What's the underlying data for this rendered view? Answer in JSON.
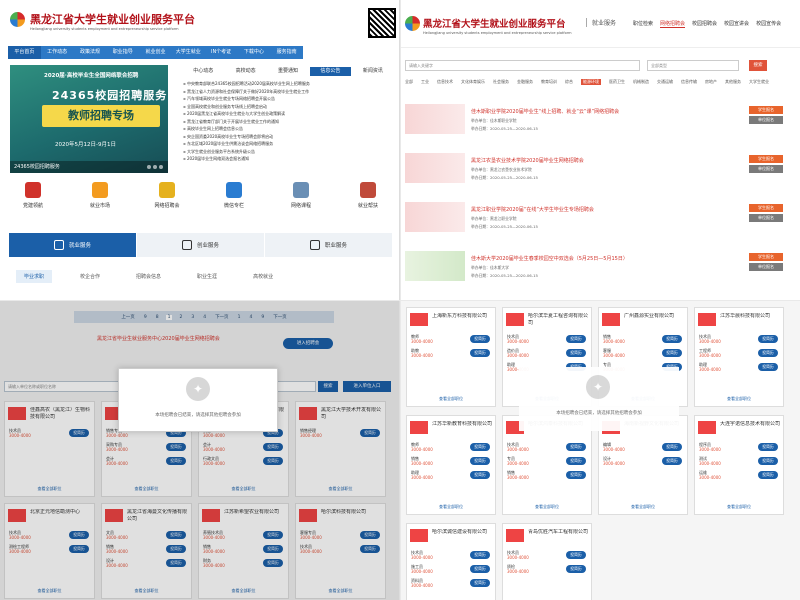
{
  "q1": {
    "title": "黑龙江省大学生就业创业服务平台",
    "subtitle": "Heilongjiang university students employment and entrepreneurship service platform",
    "nav": [
      "平台首页",
      "工作动态",
      "政策法规",
      "职业指导",
      "就业创业",
      "大学生就业",
      "IN个考证",
      "下载中心",
      "服务指南"
    ],
    "banner": {
      "header": "2020届·高校毕业生全国网络联合招聘",
      "big": "24365校园招聘服务",
      "zc": "教师招聘专场",
      "date": "2020年5月12日-9月1日",
      "foot": "24365校园招聘服务"
    },
    "news_tabs": [
      "中心动态",
      "高校动态",
      "重要通知",
      "信息公告",
      "新闻资讯"
    ],
    "news": [
      "中央教育部联合24365校园招聘活动2020届高校毕业生网上招聘服务",
      "黑龙江省人力资源和社会保障厅关于做好2020年高校毕业生就业工作",
      "汽车领域高校毕业生就业专场网络招聘会开展公告",
      "全国高校就业和创业服务专场线上招聘会启动",
      "2020届黑龙江省高校毕业生就业与大学生创业政策解读",
      "黑龙江省教育厅部门关于开展毕业生就业工作的通知",
      "高校毕业生网上招聘会信息公告",
      "央企国资委2020高校毕业生专场招聘会即将启动",
      "东北区域2020届毕业生供需洽谈会网络招聘服务",
      "大学生就业创业服务平台系统升级公告",
      "2020届毕业生网络双选会报名通知"
    ],
    "icons": [
      {
        "label": "党建领航",
        "color": "#d0322b"
      },
      {
        "label": "就业市场",
        "color": "#f39b1f"
      },
      {
        "label": "网络招聘会",
        "color": "#e5b11e"
      },
      {
        "label": "微信专栏",
        "color": "#2a7cd1"
      },
      {
        "label": "网络课程",
        "color": "#6a8fb5"
      },
      {
        "label": "就业帮扶",
        "color": "#c04a3a"
      }
    ],
    "services": [
      "就业服务",
      "创业服务",
      "职业服务"
    ],
    "subtabs": [
      "毕业求职",
      "校企合作",
      "招聘会信息",
      "职业生涯",
      "高校就业"
    ]
  },
  "q2": {
    "title": "黑龙江省大学生就业创业服务平台",
    "subtitle": "Heilongjiang university students employment and entrepreneurship service platform",
    "section": "就业服务",
    "nav": [
      "职位检索",
      "网络招聘会",
      "校园招聘会",
      "校园宣讲会",
      "校园宣传会"
    ],
    "search_placeholder": "请输入关键字",
    "search_sel": "全部类型",
    "search_btn": "搜索",
    "hot": [
      "全部",
      "工业",
      "信息技术",
      "文化体育娱乐",
      "社会服务",
      "金融服务",
      "教育培训",
      "综合",
      "能源环境",
      "医药卫生",
      "机械制造",
      "交通运输",
      "信息传输",
      "房地产",
      "其他服务",
      "大学生就业"
    ],
    "jobs": [
      {
        "title": "佳木斯职业学院2020届毕业生“线上招聘、就业“云”课”网络招聘会",
        "org": "举办单位：佳木斯职业学院",
        "date": "举办日期：2020-05-25—2020-06-15",
        "b1": "学生报名",
        "b2": "单位报名"
      },
      {
        "title": "黑龙江农垦农业技术学院2020届毕业生网络招聘会",
        "org": "举办单位：黑龙江农垦农业技术学院",
        "date": "举办日期：2020-05-25—2020-06-15",
        "b1": "学生报名",
        "b2": "单位报名"
      },
      {
        "title": "黑龙江职业学院2020届“在线”大学生毕业生专场招聘会",
        "org": "举办单位：黑龙江职业学院",
        "date": "举办日期：2020-05-25—2020-06-15",
        "b1": "学生报名",
        "b2": "单位报名"
      },
      {
        "title": "佳木斯大学2020届毕业生春季校园空中双选会（5月25日—5月15日）",
        "org": "举办单位：佳木斯大学",
        "date": "举办日期：2020-05-25—2020-06-15",
        "b1": "学生报名",
        "b2": "单位报名"
      }
    ]
  },
  "q3": {
    "pager": [
      "上一页",
      "9",
      "8",
      "1",
      "2",
      "3",
      "4",
      "下一页",
      "1",
      "4",
      "9",
      "下一页"
    ],
    "alert": "黑龙江省毕业生就业服务中心2020届毕业生网络招聘会",
    "pill_btn": "进入招聘会",
    "search_placeholder": "请输入单位名称或职位名称",
    "search_btn": "搜索",
    "enter_btn": "进入单位入口",
    "modal_msg": "本场招聘会已结束，请选择其他招聘会参加",
    "apply": "投简历",
    "more": "查看全部职位",
    "cards": [
      {
        "name": "佳鑫高农（黑龙江）生物科技有限公司",
        "rows": [
          [
            "技术员",
            "3000-4000"
          ]
        ]
      },
      {
        "name": "黑龙江省建设投资集团有限公司",
        "rows": [
          [
            "销售专员",
            "3000-4000"
          ],
          [
            "采购专员",
            "3000-4000"
          ],
          [
            "会计",
            "3000-4000"
          ]
        ]
      },
      {
        "name": "黑龙江省环境保护科技有限公司",
        "rows": [
          [
            "销售",
            "3000-4000"
          ],
          [
            "会计",
            "3000-4000"
          ],
          [
            "行政文员",
            "3000-4000"
          ]
        ]
      },
      {
        "name": "黑龙江大学技术开发有限公司",
        "rows": [
          [
            "销售经理",
            "3000-4000"
          ]
        ]
      },
      {
        "name": "北京正元地信勘测中心",
        "rows": [
          [
            "技术员",
            "3000-4000"
          ],
          [
            "测绘工程师",
            "3000-4000"
          ]
        ]
      },
      {
        "name": "黑龙江省海曼文化传播有限公司",
        "rows": [
          [
            "文员",
            "3000-4000"
          ],
          [
            "销售",
            "3000-4000"
          ],
          [
            "设计",
            "3000-4000"
          ]
        ]
      },
      {
        "name": "江苏新希望农业有限公司",
        "rows": [
          [
            "养殖技术员",
            "3000-4000"
          ],
          [
            "销售",
            "3000-4000"
          ],
          [
            "财务",
            "3000-4000"
          ]
        ]
      },
      {
        "name": "哈尔滨科技有限公司",
        "rows": [
          [
            "客服专员",
            "3000-4000"
          ],
          [
            "技术员",
            "3000-4000"
          ]
        ]
      }
    ]
  },
  "q4": {
    "modal_msg": "本场招聘会已结束，请选择其他招聘会参加",
    "apply": "投简历",
    "more": "查看全部职位",
    "cards": [
      {
        "name": "上海新东方科技有限公司",
        "rows": [
          [
            "教师",
            "3000-4000"
          ],
          [
            "助教",
            "3000-4000"
          ]
        ]
      },
      {
        "name": "哈尔滨华夏工程咨询有限公司",
        "rows": [
          [
            "技术员",
            "3000-4000"
          ],
          [
            "造价员",
            "3000-4000"
          ],
          [
            "助理",
            "3000-4000"
          ]
        ]
      },
      {
        "name": "广州鑫源实业有限公司",
        "rows": [
          [
            "销售",
            "3000-4000"
          ],
          [
            "客服",
            "3000-4000"
          ],
          [
            "专员",
            "3000-4000"
          ]
        ]
      },
      {
        "name": "江苏华晨科技有限公司",
        "rows": [
          [
            "技术员",
            "3000-4000"
          ],
          [
            "工程师",
            "3000-4000"
          ],
          [
            "助理",
            "3000-4000"
          ]
        ]
      },
      {
        "name": "江苏华新教育科技有限公司",
        "rows": [
          [
            "教师",
            "3000-4000"
          ],
          [
            "销售",
            "3000-4000"
          ],
          [
            "助理",
            "3000-4000"
          ]
        ]
      },
      {
        "name": "哈尔滨鸿泰科技有限公司",
        "rows": [
          [
            "技术员",
            "3000-4000"
          ],
          [
            "专员",
            "3000-4000"
          ],
          [
            "销售",
            "3000-4000"
          ]
        ]
      },
      {
        "name": "海南新视野文化有限公司",
        "rows": [
          [
            "编辑",
            "3000-4000"
          ],
          [
            "设计",
            "3000-4000"
          ]
        ]
      },
      {
        "name": "大连宇诺信息技术有限公司",
        "rows": [
          [
            "程序员",
            "3000-4000"
          ],
          [
            "测试",
            "3000-4000"
          ],
          [
            "运维",
            "3000-4000"
          ]
        ]
      },
      {
        "name": "哈尔滨诚信建设有限公司",
        "rows": [
          [
            "技术员",
            "3000-4000"
          ],
          [
            "施工员",
            "3000-4000"
          ],
          [
            "资料员",
            "3000-4000"
          ]
        ]
      },
      {
        "name": "青岛优胜汽车工程有限公司",
        "rows": [
          [
            "技术员",
            "3000-4000"
          ],
          [
            "质检",
            "3000-4000"
          ]
        ]
      }
    ]
  }
}
